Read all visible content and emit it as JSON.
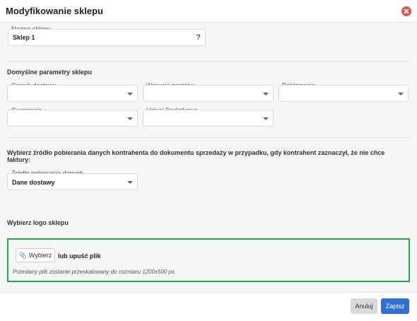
{
  "dialog": {
    "title": "Modyfikowanie sklepu"
  },
  "shop_name": {
    "label": "Nazwa sklepu",
    "value": "Sklep 1",
    "help": "?"
  },
  "defaults": {
    "heading": "Domyślne parametry sklepu",
    "shipping_price_list": {
      "label": "Cennik dostawy",
      "value": ""
    },
    "return_terms": {
      "label": "Warunki zwrotów",
      "value": ""
    },
    "complaints": {
      "label": "Reklamacje",
      "value": ""
    },
    "warranty": {
      "label": "Gwarancje",
      "value": ""
    },
    "extra_services": {
      "label": "Usługi Dodatkowe",
      "value": ""
    }
  },
  "contractor_source": {
    "heading": "Wybierz źródło pobierania danych kontrahenta do dokumentu sprzedaży w przypadku, gdy kontrahent zaznaczył, że nie chce faktury:",
    "label": "Źródło pobierania danych",
    "value": "Dane dostawy"
  },
  "logo": {
    "heading": "Wybierz logo sklepu",
    "choose_label": "Wybierz",
    "drop_text": "lub upuść plik",
    "hint": "Przesłany plik zostanie przeskalowany do rozmiaru 1200x500 px."
  },
  "footer": {
    "cancel_label": "Anuluj",
    "save_label": "Zapisz"
  },
  "colors": {
    "accent": "#2f6fd6",
    "dropzone_border": "#27a745",
    "close": "#d9534f"
  }
}
